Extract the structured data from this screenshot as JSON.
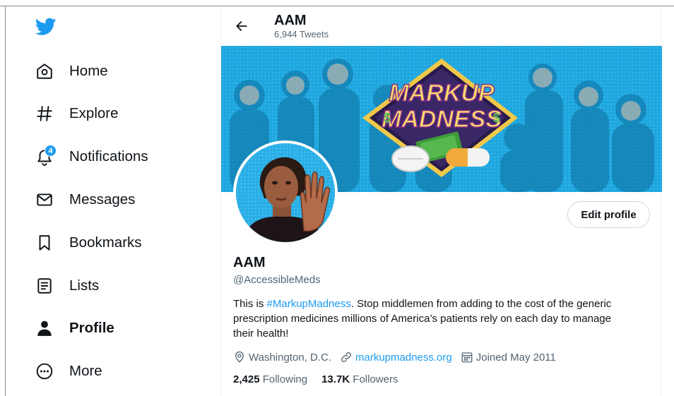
{
  "sidebar": {
    "logo_icon": "twitter-bird-icon",
    "brand_color": "#1d9bf0",
    "items": [
      {
        "label": "Home",
        "icon": "home-icon"
      },
      {
        "label": "Explore",
        "icon": "hashtag-icon"
      },
      {
        "label": "Notifications",
        "icon": "bell-icon",
        "badge": "4"
      },
      {
        "label": "Messages",
        "icon": "envelope-icon"
      },
      {
        "label": "Bookmarks",
        "icon": "bookmark-icon"
      },
      {
        "label": "Lists",
        "icon": "list-icon"
      },
      {
        "label": "Profile",
        "icon": "person-icon",
        "active": true
      },
      {
        "label": "More",
        "icon": "more-circle-icon"
      }
    ]
  },
  "header": {
    "title": "AAM",
    "subtitle": "6,944 Tweets"
  },
  "banner": {
    "line1": "MARKUP",
    "line2": "MADNESS"
  },
  "profile": {
    "name": "AAM",
    "handle": "@AccessibleMeds",
    "edit_label": "Edit profile",
    "bio_before": "This is ",
    "bio_hashtag": "#MarkupMadness",
    "bio_after": ". Stop middlemen from adding to the cost of the generic prescription medicines millions of America’s patients rely on each day to manage their health!",
    "location": "Washington, D.C.",
    "website": "markupmadness.org",
    "joined": "Joined May 2011",
    "following_count": "2,425",
    "following_label": "Following",
    "followers_count": "13.7K",
    "followers_label": "Followers"
  }
}
